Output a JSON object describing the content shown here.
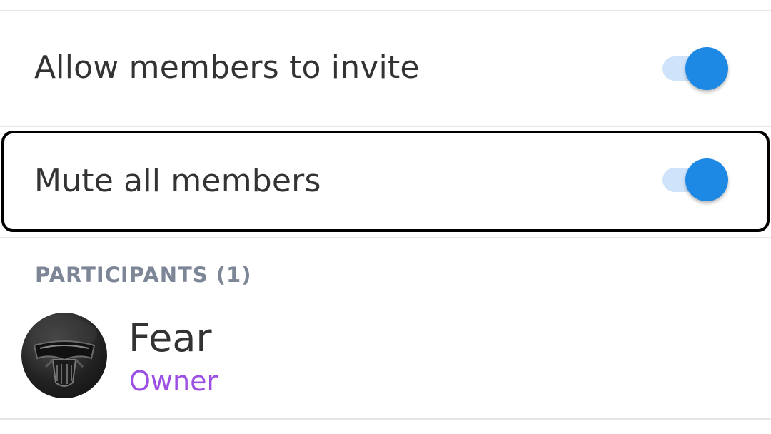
{
  "settings": {
    "allow_invite": {
      "label": "Allow members to invite",
      "enabled": true
    },
    "mute_all": {
      "label": "Mute all members",
      "enabled": true
    }
  },
  "participants_section": {
    "header": "PARTICIPANTS (1)",
    "items": [
      {
        "name": "Fear",
        "role": "Owner",
        "avatar_icon": "masked-helmet-avatar"
      }
    ]
  },
  "colors": {
    "toggle_thumb": "#1e88e5",
    "toggle_track": "#cfe4fb",
    "role_owner": "#9b4fe3",
    "section_header": "#7c8696",
    "primary_text": "#333333",
    "divider": "#e6e6e6",
    "focus_outline": "#000000"
  }
}
